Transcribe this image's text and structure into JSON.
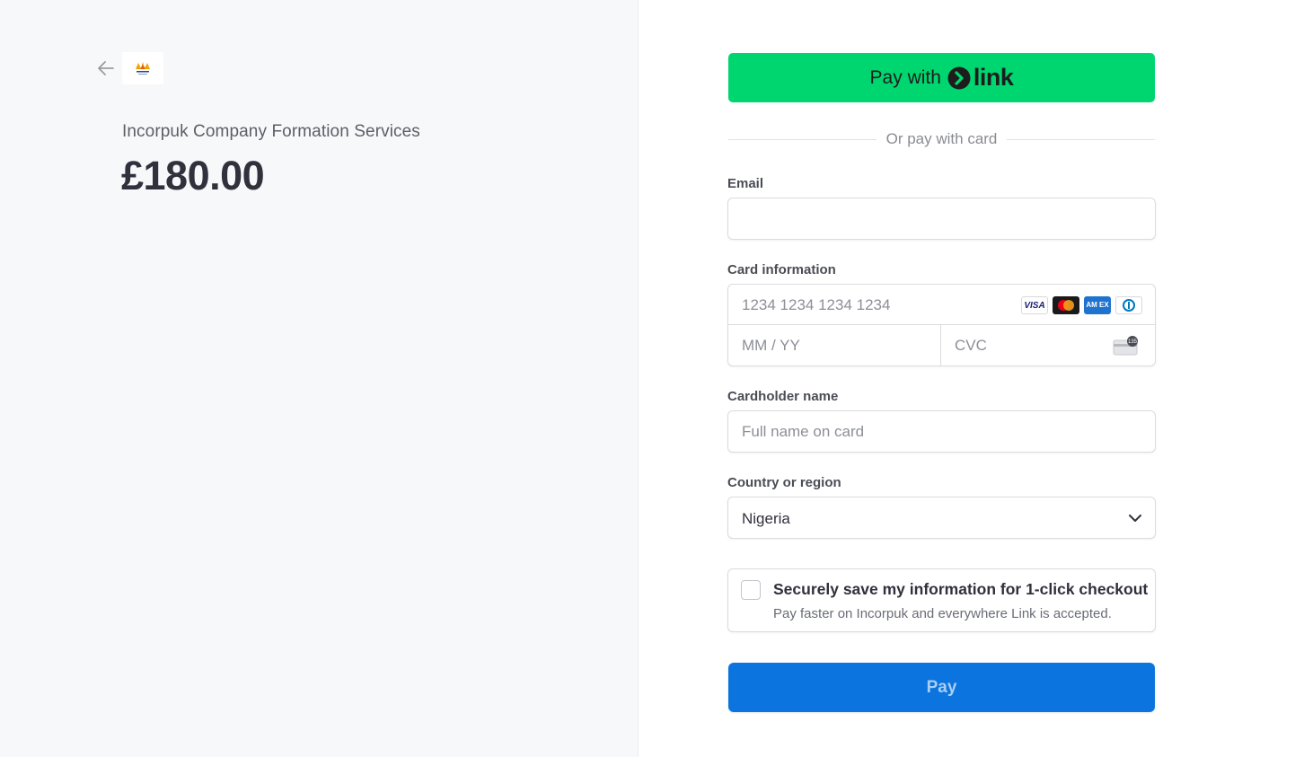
{
  "summary": {
    "back_icon": "arrow-left-icon",
    "logo_icon": "merchant-logo-icon",
    "merchant_name": "Incorpuk Company Formation Services",
    "amount": "£180.00"
  },
  "form": {
    "link_button": {
      "prefix": "Pay with",
      "brand": "link",
      "background_color": "#00d66f"
    },
    "divider_text": "Or pay with card",
    "email": {
      "label": "Email",
      "value": "",
      "placeholder": ""
    },
    "card": {
      "label": "Card information",
      "number_placeholder": "1234 1234 1234 1234",
      "expiry_placeholder": "MM / YY",
      "cvc_placeholder": "CVC",
      "brands": [
        "visa",
        "mastercard",
        "amex",
        "diners"
      ],
      "visa_text": "VISA",
      "amex_text": "AM EX",
      "cvc_icon_text": "135"
    },
    "cardholder": {
      "label": "Cardholder name",
      "placeholder": "Full name on card"
    },
    "country": {
      "label": "Country or region",
      "selected": "Nigeria"
    },
    "save_info": {
      "checked": false,
      "title": "Securely save my information for 1-click checkout",
      "subtitle": "Pay faster on Incorpuk and everywhere Link is accepted."
    },
    "pay_button": {
      "label": "Pay",
      "background_color": "#0b74de"
    }
  }
}
